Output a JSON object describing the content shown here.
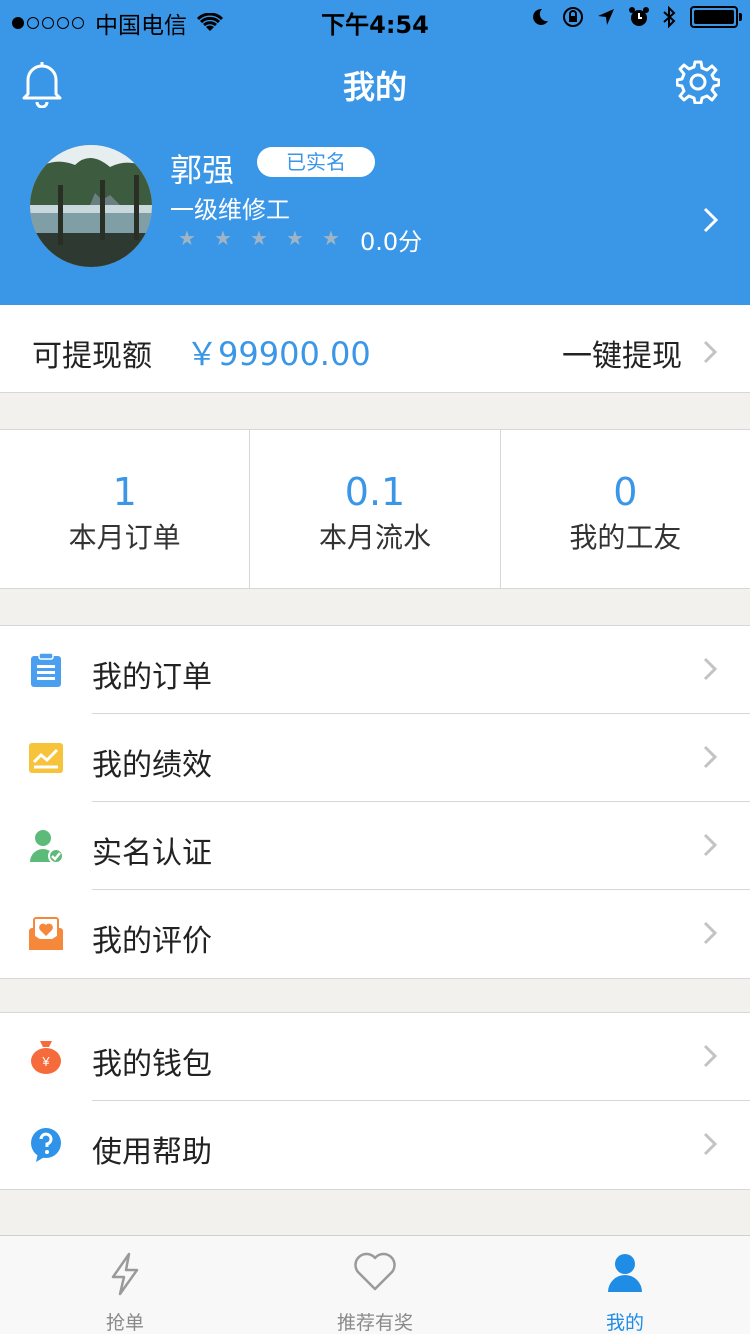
{
  "status_bar": {
    "carrier": "中国电信",
    "time": "下午4:54"
  },
  "nav": {
    "title": "我的"
  },
  "profile": {
    "name": "郭强",
    "badge": "已实名",
    "level": "一级维修工",
    "stars_filled": 0,
    "stars_total": 5,
    "rating": "0.0分"
  },
  "withdraw": {
    "label": "可提现额",
    "amount": "￥99900.00",
    "action": "一键提现"
  },
  "stats": [
    {
      "value": "1",
      "label": "本月订单"
    },
    {
      "value": "0.1",
      "label": "本月流水"
    },
    {
      "value": "0",
      "label": "我的工友"
    }
  ],
  "menu_group_1": [
    {
      "label": "我的订单",
      "icon": "clipboard-icon",
      "color": "#4a9ff0"
    },
    {
      "label": "我的绩效",
      "icon": "chart-icon",
      "color": "#f7c33b"
    },
    {
      "label": "实名认证",
      "icon": "user-verified-icon",
      "color": "#5dbb7a"
    },
    {
      "label": "我的评价",
      "icon": "review-icon",
      "color": "#f5883b"
    }
  ],
  "menu_group_2": [
    {
      "label": "我的钱包",
      "icon": "wallet-icon",
      "color": "#f56b3b"
    },
    {
      "label": "使用帮助",
      "icon": "help-icon",
      "color": "#2f93ea"
    }
  ],
  "tabbar": [
    {
      "label": "抢单",
      "icon": "lightning-icon"
    },
    {
      "label": "推荐有奖",
      "icon": "heart-icon"
    },
    {
      "label": "我的",
      "icon": "user-icon",
      "active": true
    }
  ],
  "colors": {
    "primary": "#3a96e7",
    "background": "#f2f1ee"
  }
}
